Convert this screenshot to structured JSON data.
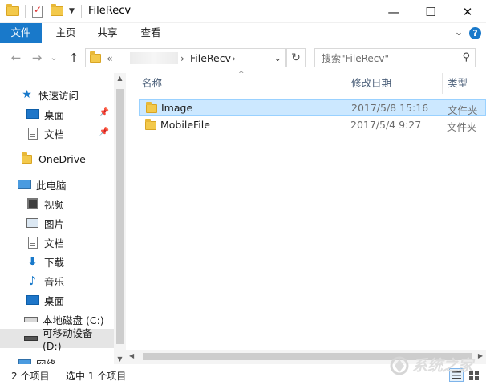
{
  "window": {
    "title": "FileRecv",
    "minimize": "—",
    "maximize": "☐",
    "close": "✕"
  },
  "ribbon": {
    "tabs": [
      "文件",
      "主页",
      "共享",
      "查看"
    ],
    "expand": "⌄",
    "help": "?"
  },
  "address": {
    "back": "←",
    "forward": "→",
    "history": "⌄",
    "up": "↑",
    "overflow": "«",
    "crumb_sep": "›",
    "current": "FileRecv",
    "dropdown": "⌄",
    "refresh": "↻"
  },
  "search": {
    "placeholder": "搜索\"FileRecv\"",
    "icon": "search-icon"
  },
  "sidebar": {
    "items": [
      {
        "label": "快速访问",
        "icon": "quick-access-star-icon"
      },
      {
        "label": "桌面",
        "icon": "desktop-icon",
        "pinned": true
      },
      {
        "label": "文档",
        "icon": "documents-icon",
        "pinned": true
      },
      {
        "label": "OneDrive",
        "icon": "onedrive-folder-icon"
      },
      {
        "label": "此电脑",
        "icon": "this-pc-icon"
      },
      {
        "label": "视频",
        "icon": "videos-icon"
      },
      {
        "label": "图片",
        "icon": "pictures-icon"
      },
      {
        "label": "文档",
        "icon": "documents-icon"
      },
      {
        "label": "下载",
        "icon": "downloads-icon"
      },
      {
        "label": "音乐",
        "icon": "music-icon"
      },
      {
        "label": "桌面",
        "icon": "desktop-icon"
      },
      {
        "label": "本地磁盘 (C:)",
        "icon": "local-disk-icon"
      },
      {
        "label": "可移动设备 (D:)",
        "icon": "removable-drive-icon",
        "selected": true
      },
      {
        "label": "网络",
        "icon": "network-icon"
      }
    ],
    "pin_glyph": "📌"
  },
  "columns": {
    "name": "名称",
    "modified": "修改日期",
    "type": "类型",
    "sort_glyph": "^"
  },
  "files": [
    {
      "name": "Image",
      "modified": "2017/5/8 15:16",
      "type": "文件夹",
      "selected": true
    },
    {
      "name": "MobileFile",
      "modified": "2017/5/4 9:27",
      "type": "文件夹",
      "selected": false
    }
  ],
  "status": {
    "item_count": "2 个项目",
    "selected_count": "选中 1 个项目"
  },
  "colors": {
    "accent": "#1979ca",
    "selection_fill": "#cce8ff",
    "selection_border": "#99d1ff",
    "folder": "#f3c94b"
  }
}
